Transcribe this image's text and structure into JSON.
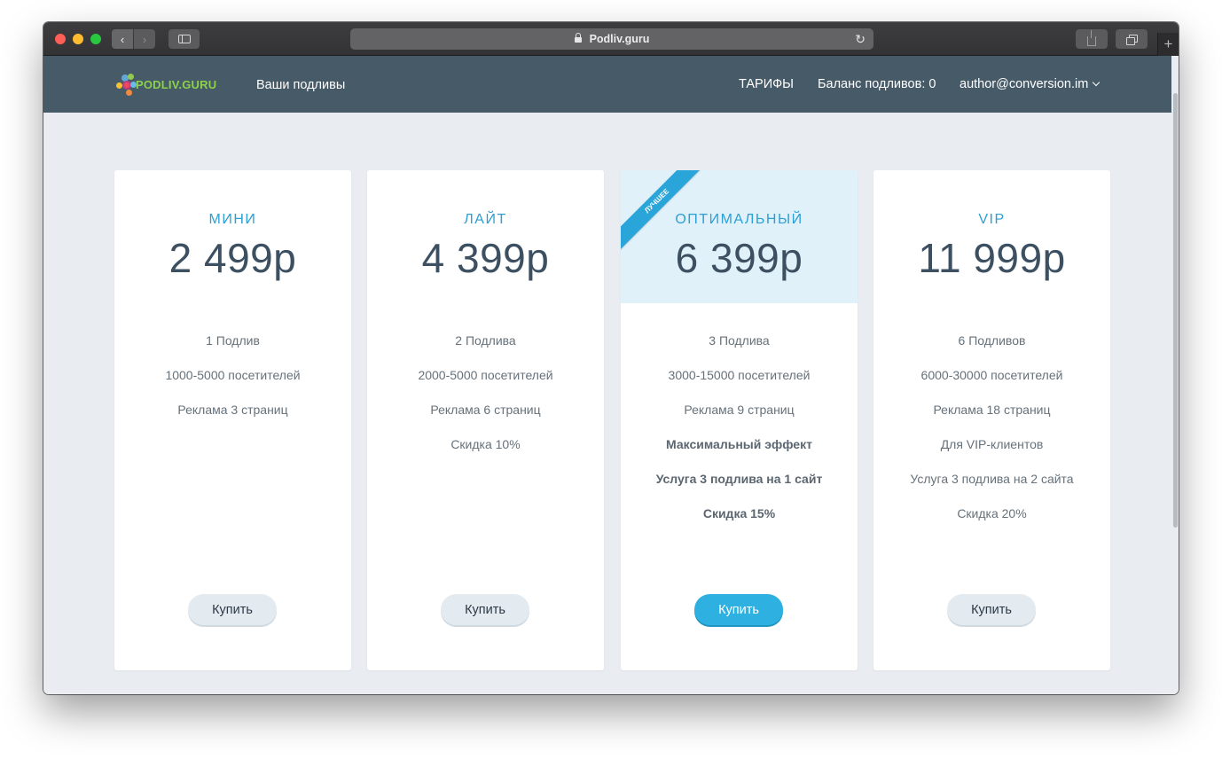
{
  "browser": {
    "url": "Podliv.guru",
    "colors": {
      "close": "#fd5f57",
      "minimize": "#febc2e",
      "zoom": "#28c840"
    }
  },
  "header": {
    "logo_text": "PODLIV.GURU",
    "nav_yours": "Ваши подливы",
    "nav_tariffs": "ТАРИФЫ",
    "balance": "Баланс подливов: 0",
    "user": "author@conversion.im"
  },
  "plans": [
    {
      "title": "МИНИ",
      "price": "2 499р",
      "features": [
        "1 Подлив",
        "1000-5000 посетителей",
        "Реклама 3 страниц"
      ],
      "buy": "Купить"
    },
    {
      "title": "ЛАЙТ",
      "price": "4 399р",
      "features": [
        "2 Подлива",
        "2000-5000 посетителей",
        "Реклама 6 страниц",
        "Скидка 10%"
      ],
      "buy": "Купить"
    },
    {
      "title": "ОПТИМАЛЬНЫЙ",
      "price": "6 399р",
      "ribbon": "ЛУЧШЕЕ",
      "features": [
        "3 Подлива",
        "3000-15000 посетителей",
        "Реклама 9 страниц",
        "Максимальный эффект",
        "Услуга 3 подлива на 1 сайт",
        "Скидка 15%"
      ],
      "buy": "Купить"
    },
    {
      "title": "VIP",
      "price": "11 999р",
      "features": [
        "6 Подливов",
        "6000-30000 посетителей",
        "Реклама 18 страниц",
        "Для VIP-клиентов",
        "Услуга 3 подлива на 2 сайта",
        "Скидка 20%"
      ],
      "buy": "Купить"
    }
  ],
  "colors": {
    "header_bg": "#465a68",
    "page_bg": "#e9edf1",
    "accent": "#2eb1e0",
    "title": "#2d9fd4",
    "price": "#3c5062",
    "featured_bg": "#e0f1f9"
  }
}
